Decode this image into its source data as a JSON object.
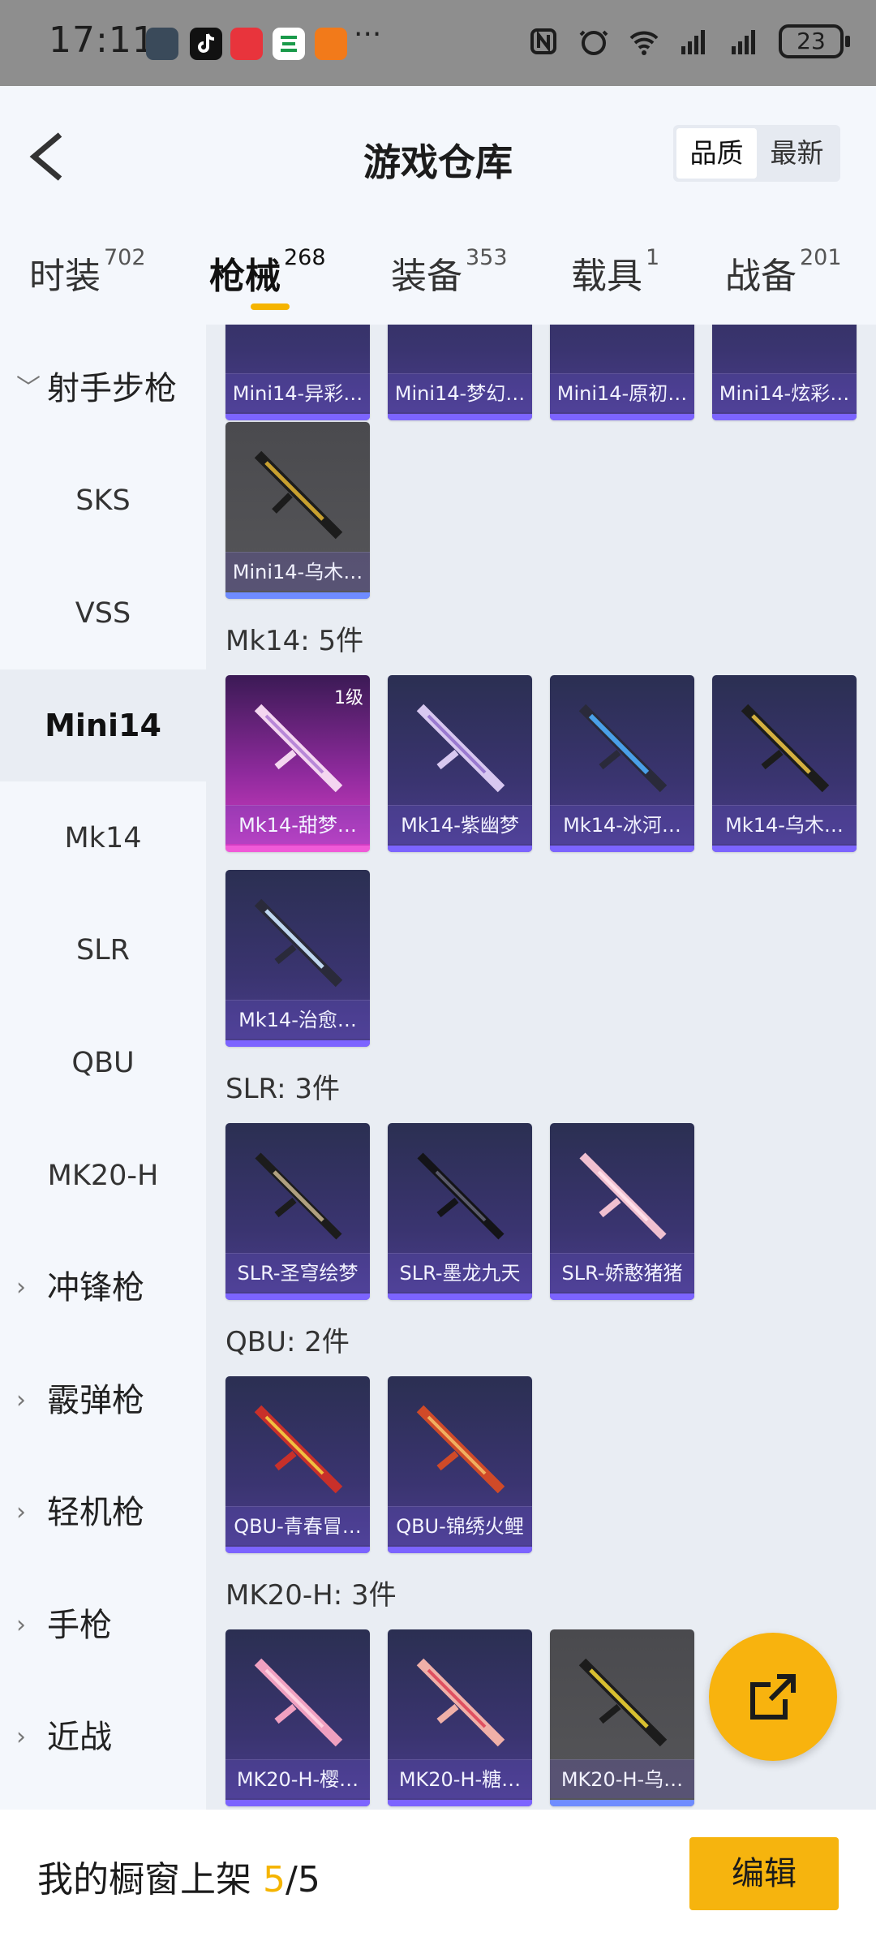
{
  "status_bar": {
    "time": "17:11",
    "more": "···",
    "battery": "23",
    "icons": [
      "avatar-icon",
      "tiktok-icon",
      "red-app-icon",
      "green-app-icon",
      "orange-app-icon",
      "nfc-icon",
      "alarm-icon",
      "wifi-icon",
      "signal-icon",
      "signal-icon",
      "battery-icon"
    ]
  },
  "header": {
    "title": "游戏仓库",
    "sort_options": [
      "品质",
      "最新"
    ],
    "active_sort": "品质"
  },
  "tabs": [
    {
      "label": "时装",
      "count": "702"
    },
    {
      "label": "枪械",
      "count": "268",
      "active": true
    },
    {
      "label": "装备",
      "count": "353"
    },
    {
      "label": "载具",
      "count": "1"
    },
    {
      "label": "战备",
      "count": "201"
    }
  ],
  "sidebar": {
    "group_expanded": "射手步枪",
    "sub_items": [
      "SKS",
      "VSS",
      "Mini14",
      "Mk14",
      "SLR",
      "QBU",
      "MK20-H"
    ],
    "active_item": "Mini14",
    "groups_collapsed": [
      "冲锋枪",
      "霰弹枪",
      "轻机枪",
      "手枪",
      "近战"
    ]
  },
  "content": {
    "mini14_top_row": [
      "Mini14-异彩…",
      "Mini14-梦幻…",
      "Mini14-原初…",
      "Mini14-炫彩…"
    ],
    "mini14_last": [
      "Mini14-乌木…"
    ],
    "sections": [
      {
        "title": "Mk14: 5件",
        "items": [
          "Mk14-甜梦…",
          "Mk14-紫幽梦",
          "Mk14-冰河…",
          "Mk14-乌木…",
          "Mk14-治愈…"
        ],
        "level_badge": "1级"
      },
      {
        "title": "SLR: 3件",
        "items": [
          "SLR-圣穹绘梦",
          "SLR-墨龙九天",
          "SLR-娇憨猪猪"
        ]
      },
      {
        "title": "QBU: 2件",
        "items": [
          "QBU-青春冒…",
          "QBU-锦绣火鲤"
        ]
      },
      {
        "title": "MK20-H: 3件",
        "items": [
          "MK20-H-樱…",
          "MK20-H-糖…",
          "MK20-H-乌…"
        ]
      }
    ]
  },
  "bottom": {
    "showcase_label": "我的橱窗上架",
    "showcase_count": "5",
    "showcase_sep": "/",
    "showcase_total": "5",
    "edit_label": "编辑"
  },
  "colors": {
    "accent": "#f5b400",
    "card_purple": "#3a3470",
    "card_pink": "#d83fc6"
  }
}
